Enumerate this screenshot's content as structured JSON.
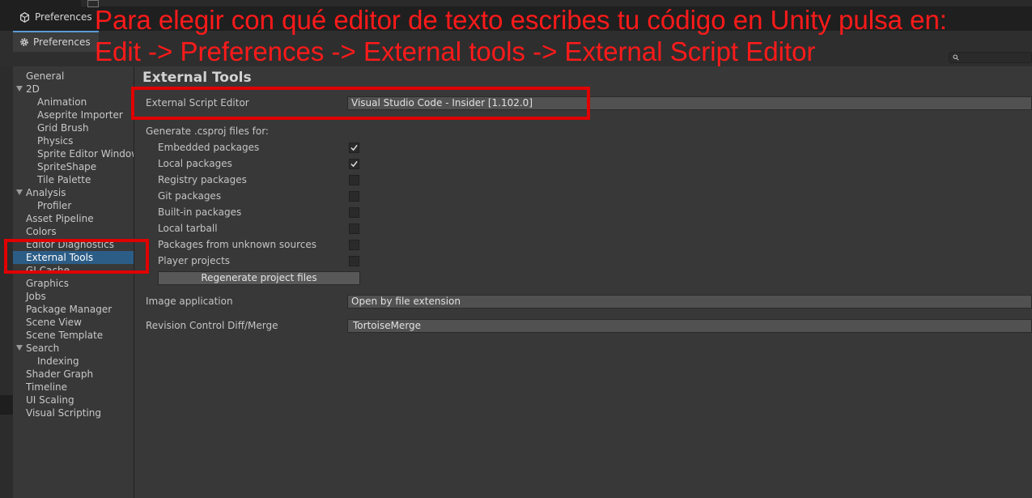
{
  "window": {
    "tab_title": "Preferences"
  },
  "panel": {
    "tab_title": "Preferences"
  },
  "overlay": {
    "line1": "Para elegir con qué editor de texto escribes tu código en Unity pulsa en:",
    "line2": "Edit -> Preferences -> External tools -> External Script Editor",
    "color": "#ff1a1a"
  },
  "sidebar": {
    "items": [
      {
        "label": "General",
        "indent": 1,
        "expanded": false
      },
      {
        "label": "2D",
        "indent": 1,
        "expanded": true
      },
      {
        "label": "Animation",
        "indent": 2
      },
      {
        "label": "Aseprite Importer",
        "indent": 2
      },
      {
        "label": "Grid Brush",
        "indent": 2
      },
      {
        "label": "Physics",
        "indent": 2
      },
      {
        "label": "Sprite Editor Window",
        "indent": 2
      },
      {
        "label": "SpriteShape",
        "indent": 2
      },
      {
        "label": "Tile Palette",
        "indent": 2
      },
      {
        "label": "Analysis",
        "indent": 1,
        "expanded": true
      },
      {
        "label": "Profiler",
        "indent": 2
      },
      {
        "label": "Asset Pipeline",
        "indent": 1
      },
      {
        "label": "Colors",
        "indent": 1
      },
      {
        "label": "Editor Diagnostics",
        "indent": 1
      },
      {
        "label": "External Tools",
        "indent": 1,
        "selected": true
      },
      {
        "label": "GI Cache",
        "indent": 1
      },
      {
        "label": "Graphics",
        "indent": 1
      },
      {
        "label": "Jobs",
        "indent": 1
      },
      {
        "label": "Package Manager",
        "indent": 1
      },
      {
        "label": "Scene View",
        "indent": 1
      },
      {
        "label": "Scene Template",
        "indent": 1
      },
      {
        "label": "Search",
        "indent": 1,
        "expanded": true
      },
      {
        "label": "Indexing",
        "indent": 2
      },
      {
        "label": "Shader Graph",
        "indent": 1
      },
      {
        "label": "Timeline",
        "indent": 1
      },
      {
        "label": "UI Scaling",
        "indent": 1
      },
      {
        "label": "Visual Scripting",
        "indent": 1
      }
    ],
    "selected_color": "#2c5d87"
  },
  "main": {
    "title": "External Tools",
    "external_script_editor": {
      "label": "External Script Editor",
      "value": "Visual Studio Code - Insider [1.102.0]"
    },
    "generate_label": "Generate .csproj files for:",
    "packages": [
      {
        "label": "Embedded packages",
        "checked": true
      },
      {
        "label": "Local packages",
        "checked": true
      },
      {
        "label": "Registry packages",
        "checked": false
      },
      {
        "label": "Git packages",
        "checked": false
      },
      {
        "label": "Built-in packages",
        "checked": false
      },
      {
        "label": "Local tarball",
        "checked": false
      },
      {
        "label": "Packages from unknown sources",
        "checked": false
      },
      {
        "label": "Player projects",
        "checked": false
      }
    ],
    "regenerate_button": "Regenerate project files",
    "image_application": {
      "label": "Image application",
      "value": "Open by file extension"
    },
    "revision_control": {
      "label": "Revision Control Diff/Merge",
      "value": "TortoiseMerge"
    }
  }
}
